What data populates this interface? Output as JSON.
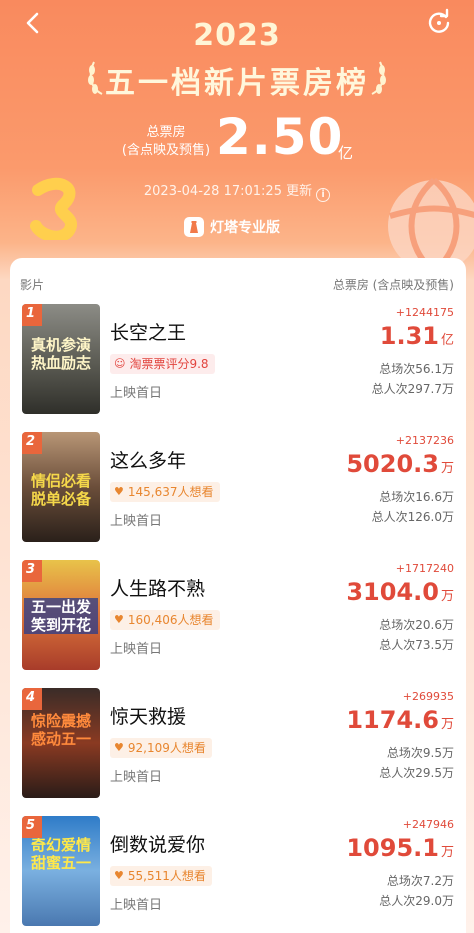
{
  "header": {
    "year": "2023",
    "title": "五一档新片票房榜",
    "total_label_1": "总票房",
    "total_label_2": "(含点映及预售)",
    "total_value": "2.50",
    "total_unit": "亿",
    "update_time": "2023-04-28 17:01:25 更新",
    "brand": "灯塔专业版"
  },
  "list": {
    "col_left": "影片",
    "col_right": "总票房 (含点映及预售)",
    "movies": [
      {
        "rank": "1",
        "poster_text": "真机参演热血励志",
        "name": "长空之王",
        "tag": "淘票票评分9.8",
        "tag_type": "taopiao",
        "release": "上映首日",
        "delta": "+1244175",
        "gross": "1.31",
        "unit": "亿",
        "sessions": "总场次56.1万",
        "admissions": "总人次297.7万"
      },
      {
        "rank": "2",
        "poster_text": "情侣必看脱单必备",
        "name": "这么多年",
        "tag": "145,637人想看",
        "tag_type": "want",
        "release": "上映首日",
        "delta": "+2137236",
        "gross": "5020.3",
        "unit": "万",
        "sessions": "总场次16.6万",
        "admissions": "总人次126.0万"
      },
      {
        "rank": "3",
        "poster_text": "五一出发笑到开花",
        "name": "人生路不熟",
        "tag": "160,406人想看",
        "tag_type": "want",
        "release": "上映首日",
        "delta": "+1717240",
        "gross": "3104.0",
        "unit": "万",
        "sessions": "总场次20.6万",
        "admissions": "总人次73.5万"
      },
      {
        "rank": "4",
        "poster_text": "惊险震撼感动五一",
        "name": "惊天救援",
        "tag": "92,109人想看",
        "tag_type": "want",
        "release": "上映首日",
        "delta": "+269935",
        "gross": "1174.6",
        "unit": "万",
        "sessions": "总场次9.5万",
        "admissions": "总人次29.5万"
      },
      {
        "rank": "5",
        "poster_text": "奇幻爱情甜蜜五一",
        "name": "倒数说爱你",
        "tag": "55,511人想看",
        "tag_type": "want",
        "release": "上映首日",
        "delta": "+247946",
        "gross": "1095.1",
        "unit": "万",
        "sessions": "总场次7.2万",
        "admissions": "总人次29.0万"
      }
    ]
  },
  "colors": {
    "accent_red": "#e04a3a",
    "header_orange": "#f98a5e"
  },
  "icons": [
    "back-arrow-icon",
    "refresh-icon",
    "info-icon",
    "taopiao-icon",
    "heart-icon",
    "laurel-icon"
  ]
}
